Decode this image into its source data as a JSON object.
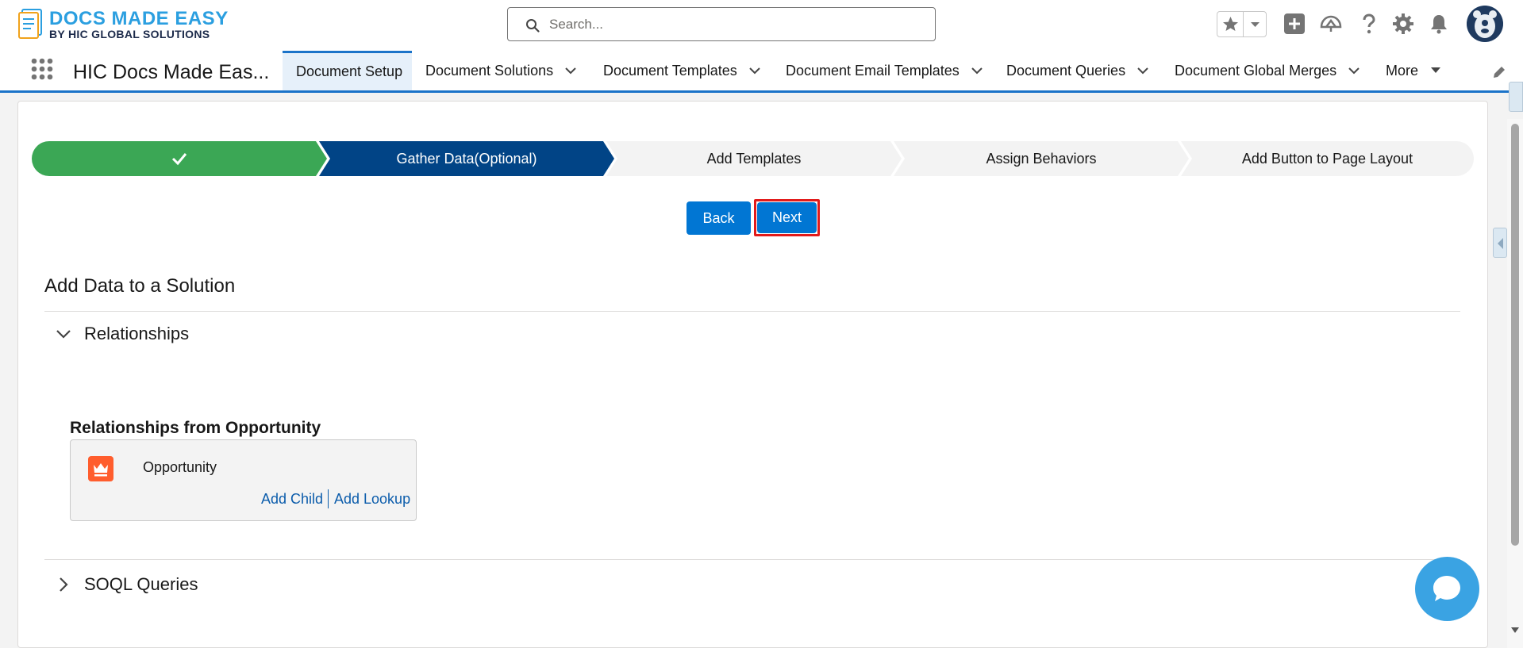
{
  "header": {
    "logo_title": "DOCS MADE EASY",
    "logo_subtitle": "BY HIC GLOBAL SOLUTIONS",
    "search_placeholder": "Search...",
    "icons": [
      "star-icon",
      "chevron-down-icon",
      "add-icon",
      "trailhead-icon",
      "help-icon",
      "setup-gear-icon",
      "bell-icon",
      "avatar"
    ]
  },
  "nav": {
    "app_name": "HIC Docs Made Eas...",
    "tabs": [
      {
        "label": "Document Setup",
        "active": true
      },
      {
        "label": "Document Solutions",
        "active": false
      },
      {
        "label": "Document Templates",
        "active": false
      },
      {
        "label": "Document Email Templates",
        "active": false
      },
      {
        "label": "Document Queries",
        "active": false
      },
      {
        "label": "Document Global Merges",
        "active": false
      },
      {
        "label": "More",
        "active": false
      }
    ]
  },
  "path": {
    "steps": [
      {
        "label": "",
        "state": "complete"
      },
      {
        "label": "Gather Data(Optional)",
        "state": "current"
      },
      {
        "label": "Add Templates",
        "state": "incomplete"
      },
      {
        "label": "Assign Behaviors",
        "state": "incomplete"
      },
      {
        "label": "Add Button to Page Layout",
        "state": "incomplete"
      }
    ]
  },
  "buttons": {
    "back": "Back",
    "next": "Next"
  },
  "main": {
    "section_title": "Add Data to a Solution",
    "relationships_label": "Relationships",
    "relationships_expanded": true,
    "relationships_from_title": "Relationships from Opportunity",
    "object_label": "Opportunity",
    "add_child": "Add Child",
    "add_lookup": "Add Lookup",
    "soql_label": "SOQL Queries",
    "soql_expanded": false
  },
  "colors": {
    "brand_blue": "#0176d3",
    "path_complete": "#3ba755",
    "path_current": "#014486",
    "path_incomplete": "#f3f3f3",
    "highlight_red": "#e21b1b",
    "opportunity_icon": "#ff5d2d"
  }
}
